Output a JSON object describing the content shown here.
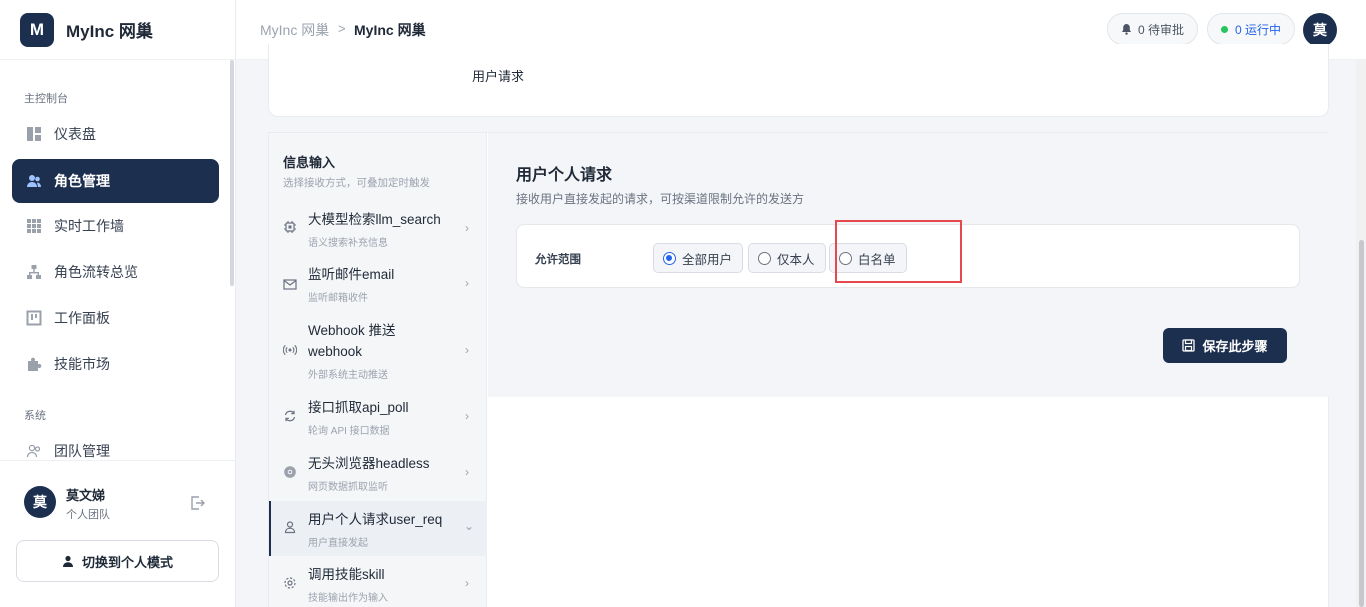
{
  "brand": {
    "logo_letter": "M",
    "name": "MyInc 网巢"
  },
  "sidebar": {
    "section_main": "主控制台",
    "items": [
      {
        "label": "仪表盘",
        "icon": "dashboard-icon",
        "active": false
      },
      {
        "label": "角色管理",
        "icon": "users-icon",
        "active": true
      },
      {
        "label": "实时工作墙",
        "icon": "grid-icon",
        "active": false
      },
      {
        "label": "角色流转总览",
        "icon": "flow-icon",
        "active": false
      },
      {
        "label": "工作面板",
        "icon": "board-icon",
        "active": false
      },
      {
        "label": "技能市场",
        "icon": "puzzle-icon",
        "active": false
      }
    ],
    "section_system": "系统",
    "system_items": [
      {
        "label": "团队管理",
        "icon": "team-icon"
      }
    ],
    "user": {
      "avatar": "莫",
      "name": "莫文娣",
      "team": "个人团队"
    },
    "switch_label": "切换到个人模式"
  },
  "topbar": {
    "breadcrumb_parent": "MyInc 网巢",
    "breadcrumb_sep": ">",
    "breadcrumb_current": "MyInc 网巢",
    "pending": "0 待审批",
    "running": "0 运行中",
    "avatar": "莫"
  },
  "top_card": {
    "label": "用户请求"
  },
  "input_panel": {
    "title": "信息输入",
    "subtitle": "选择接收方式，可叠加定时触发",
    "items": [
      {
        "title": "大模型检索llm_search",
        "sub": "语义搜索补充信息",
        "icon": "chip-icon"
      },
      {
        "title": "监听邮件email",
        "sub": "监听邮箱收件",
        "icon": "mail-icon"
      },
      {
        "title": "Webhook 推送",
        "title2": "webhook",
        "sub": "外部系统主动推送",
        "icon": "broadcast-icon"
      },
      {
        "title": "接口抓取api_poll",
        "sub": "轮询 API 接口数据",
        "icon": "refresh-icon"
      },
      {
        "title": "无头浏览器headless",
        "sub": "网页数据抓取监听",
        "icon": "browser-icon"
      },
      {
        "title": "用户个人请求user_req",
        "sub": "用户直接发起",
        "icon": "user-icon",
        "active": true
      },
      {
        "title": "调用技能skill",
        "sub": "技能输出作为输入",
        "icon": "gear-icon"
      }
    ]
  },
  "detail": {
    "title": "用户个人请求",
    "description": "接收用户直接发起的请求，可按渠道限制允许的发送方",
    "range_label": "允许范围",
    "options": [
      {
        "label": "全部用户",
        "checked": true
      },
      {
        "label": "仅本人",
        "checked": false
      },
      {
        "label": "白名单",
        "checked": false
      }
    ],
    "save_label": "保存此步骤"
  },
  "colors": {
    "primary": "#1c2f4f",
    "radio": "#2563eb",
    "highlight": "#e5484d",
    "running_dot": "#22c55e"
  }
}
